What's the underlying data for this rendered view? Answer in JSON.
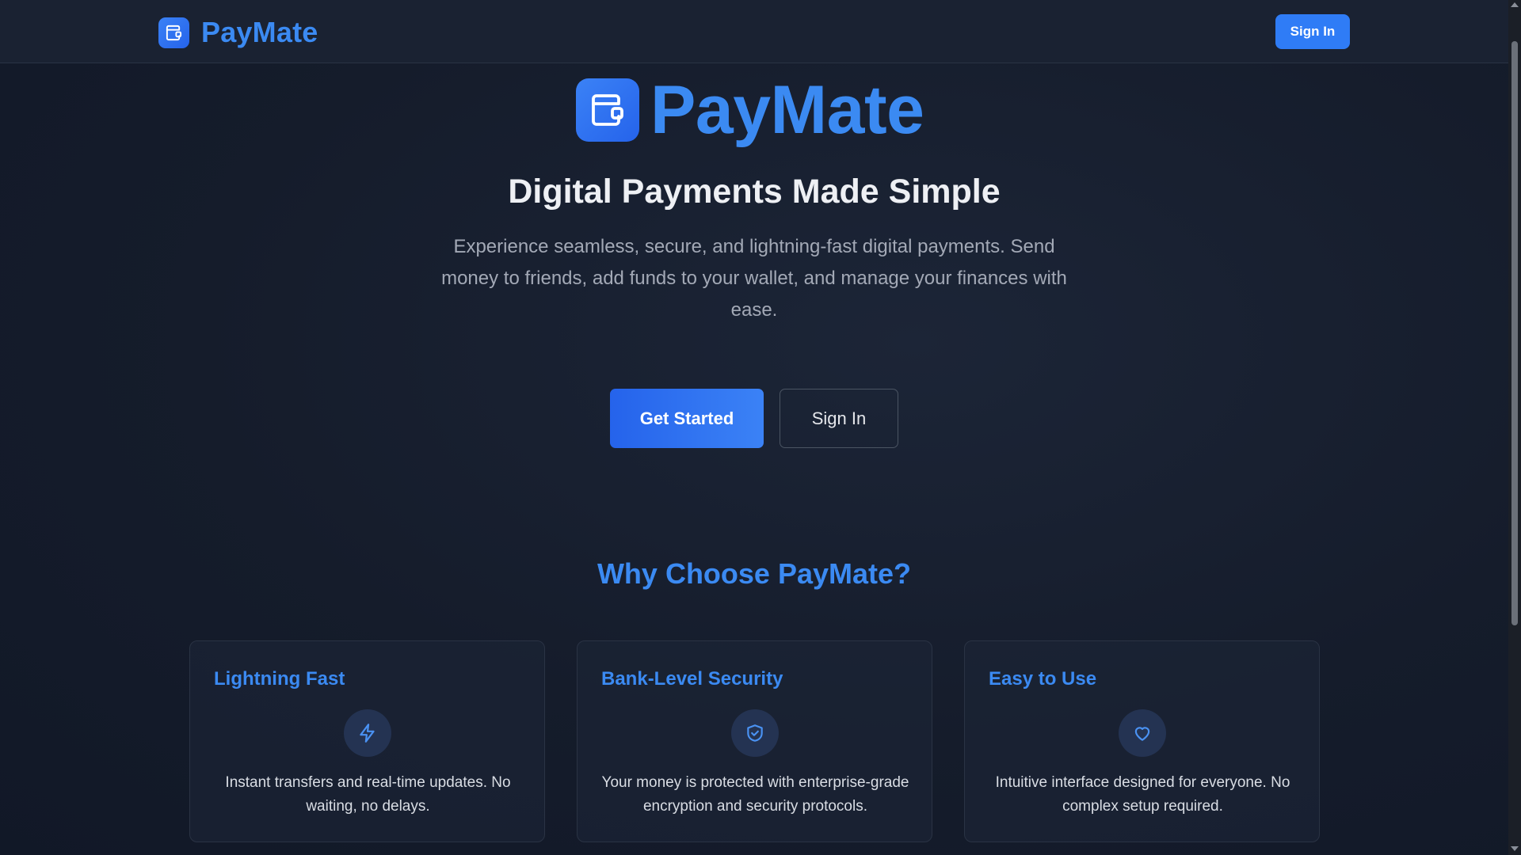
{
  "header": {
    "brand": "PayMate",
    "signin_label": "Sign In"
  },
  "hero": {
    "brand": "PayMate",
    "title": "Digital Payments Made Simple",
    "subtitle": "Experience seamless, secure, and lightning-fast digital payments. Send money to friends, add funds to your wallet, and manage your finances with ease.",
    "primary_cta": "Get Started",
    "secondary_cta": "Sign In"
  },
  "why": {
    "title": "Why Choose PayMate?",
    "features": [
      {
        "title": "Lightning Fast",
        "icon": "lightning-icon",
        "description": "Instant transfers and real-time updates. No waiting, no delays."
      },
      {
        "title": "Bank-Level Security",
        "icon": "shield-check-icon",
        "description": "Your money is protected with enterprise-grade encryption and security protocols."
      },
      {
        "title": "Easy to Use",
        "icon": "heart-icon",
        "description": "Intuitive interface designed for everyone. No complex setup required."
      }
    ]
  },
  "colors": {
    "accent": "#3b8af2",
    "primary_button": "#2f7cf6",
    "background": "#151c2b",
    "header": "#1a2232"
  }
}
